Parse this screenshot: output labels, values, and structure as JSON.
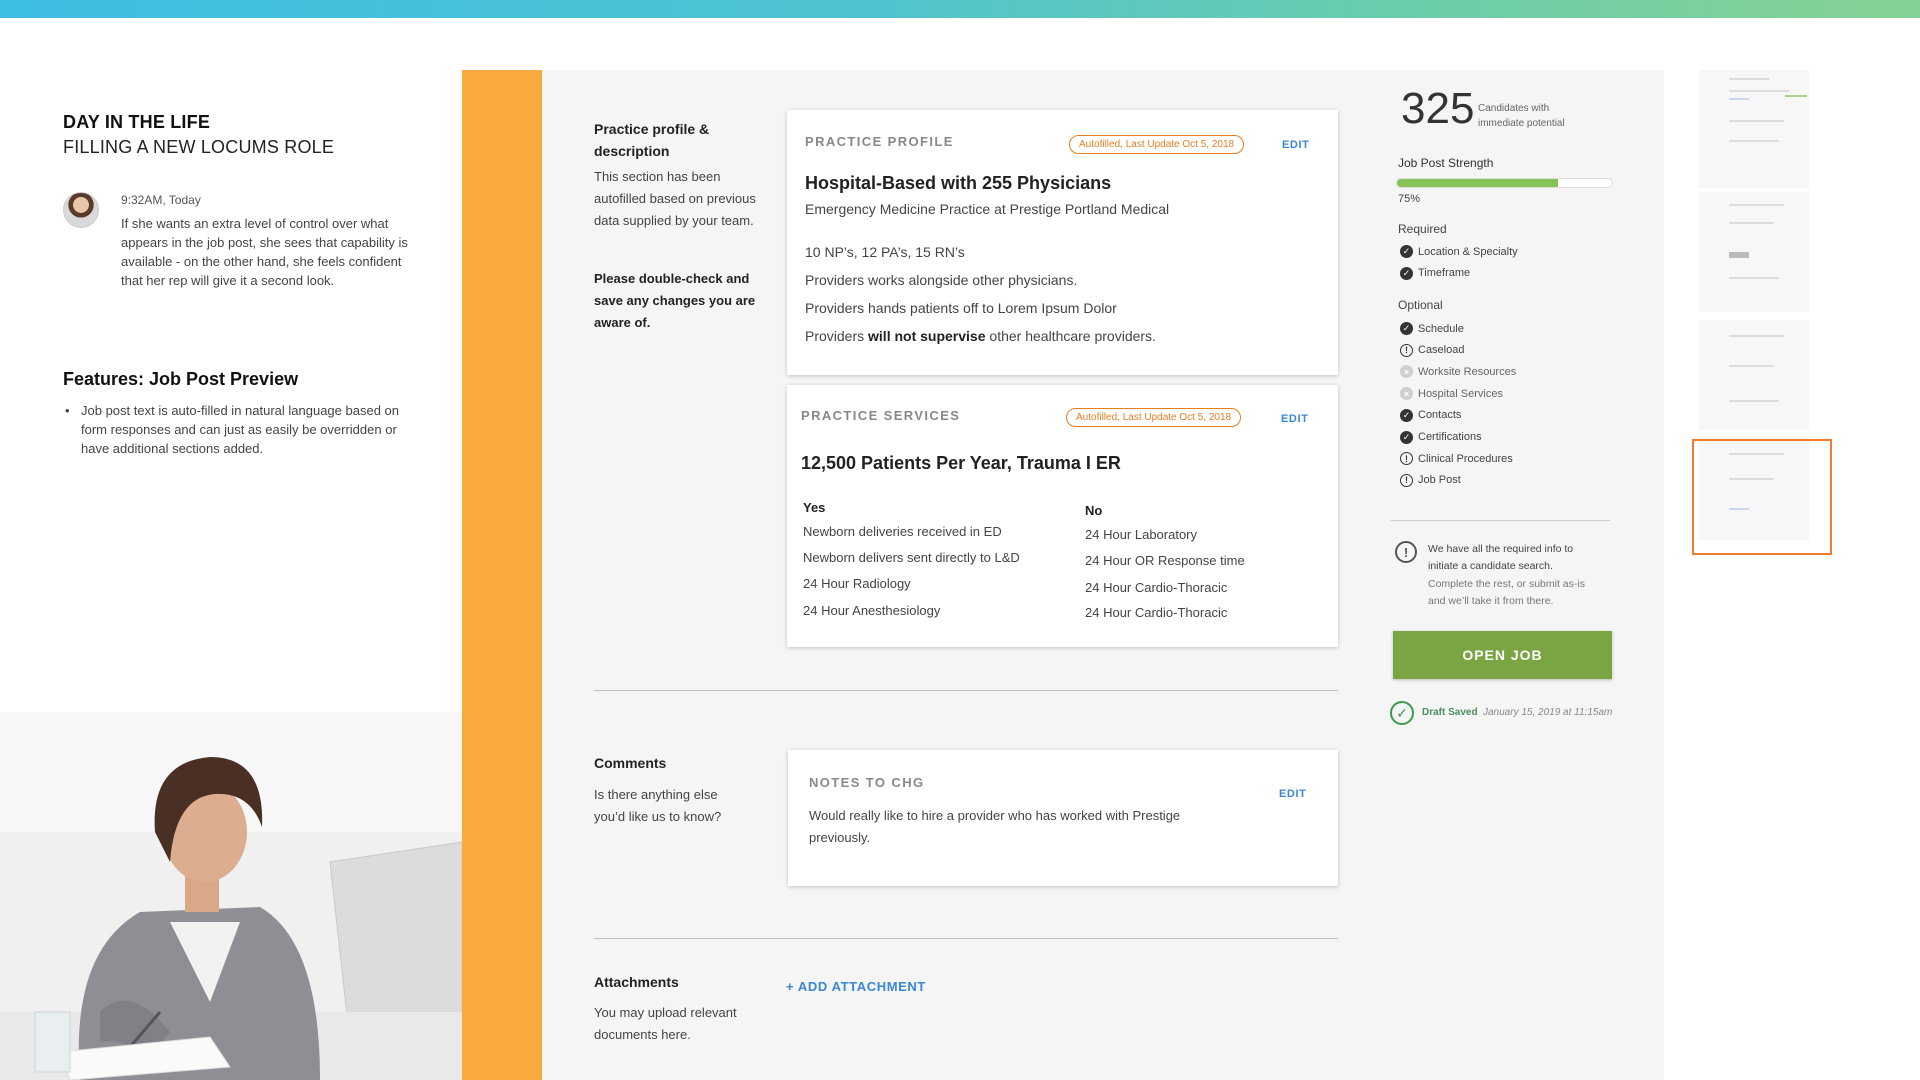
{
  "story": {
    "title": "DAY IN THE LIFE",
    "subtitle": "FILLING A NEW LOCUMS ROLE",
    "time": "9:32AM, Today",
    "text": "If she wants an extra level of control over what appears in the job post, she sees that capability is available - on the other hand, she feels confident that her rep will give it a second look.",
    "features_title": "Features: Job Post Preview",
    "features": [
      "Job post text is auto-filled in natural language based on form responses and can just as easily be overridden or have additional sections added."
    ]
  },
  "practice_section": {
    "label": "Practice profile & description",
    "desc": "This section has been autofilled based on previous data supplied by your team.",
    "desc_bold": "Please double-check and save any changes you are aware of."
  },
  "practice_profile": {
    "heading": "PRACTICE PROFILE",
    "badge": "Autofilled, Last Update Oct 5, 2018",
    "edit": "EDIT",
    "title": "Hospital-Based with 255 Physicians",
    "subtitle": "Emergency Medicine Practice at Prestige Portland Medical",
    "lines": [
      "10 NP’s, 12 PA’s, 15 RN’s",
      "Providers works alongside other physicians.",
      "Providers hands patients off to Lorem Ipsum Dolor"
    ],
    "supervise_pre": "Providers ",
    "supervise_bold": "will not supervise",
    "supervise_post": " other healthcare providers."
  },
  "practice_services": {
    "heading": "PRACTICE SERVICES",
    "badge": "Autofilled, Last Update Oct 5, 2018",
    "edit": "EDIT",
    "title": "12,500 Patients Per Year, Trauma I ER",
    "yes_label": "Yes",
    "no_label": "No",
    "yes_items": [
      "Newborn deliveries received in ED",
      "Newborn delivers sent directly to L&D",
      "24 Hour Radiology",
      "24 Hour Anesthesiology"
    ],
    "no_items": [
      "24 Hour Laboratory",
      "24 Hour OR Response time",
      "24 Hour Cardio-Thoracic",
      "24 Hour Cardio-Thoracic"
    ]
  },
  "comments": {
    "label": "Comments",
    "desc": "Is there anything else you’d like us to know?",
    "card_heading": "NOTES TO CHG",
    "edit": "EDIT",
    "note": "Would really like to hire a provider who has worked with Prestige previously."
  },
  "attachments": {
    "label": "Attachments",
    "desc": "You may upload relevant documents here.",
    "add": "+ ADD ATTACHMENT"
  },
  "sidebar": {
    "count": "325",
    "count_label": "Candidates with immediate potential",
    "strength_label": "Job Post Strength",
    "strength_pct": "75%",
    "strength_value": 0.75,
    "required_label": "Required",
    "optional_label": "Optional",
    "required": [
      {
        "label": "Location & Specialty",
        "status": "done"
      },
      {
        "label": "Timeframe",
        "status": "done"
      }
    ],
    "optional": [
      {
        "label": "Schedule",
        "status": "done"
      },
      {
        "label": "Caseload",
        "status": "warn"
      },
      {
        "label": "Worksite Resources",
        "status": "none"
      },
      {
        "label": "Hospital Services",
        "status": "none"
      },
      {
        "label": "Contacts",
        "status": "done"
      },
      {
        "label": "Certifications",
        "status": "done"
      },
      {
        "label": "Clinical Procedures",
        "status": "warn"
      },
      {
        "label": "Job Post",
        "status": "warn"
      }
    ],
    "info_strong": "We have all the required info to initiate a candidate search.",
    "info_muted": "Complete the rest, or submit as-is and we’ll take it from there.",
    "open_job": "OPEN JOB",
    "draft_label": "Draft Saved",
    "draft_time": "January 15, 2019 at 11:15am"
  },
  "icons": {
    "check": "check-circle-icon",
    "warn": "exclamation-circle-icon",
    "none": "x-circle-icon",
    "info": "info-circle-icon",
    "draft": "check-outline-icon"
  },
  "colors": {
    "accent_orange": "#f8aa3e",
    "badge_orange": "#e67e22",
    "link_blue": "#3a87d6",
    "button_green": "#7ba543",
    "progress_green": "#86c356"
  }
}
